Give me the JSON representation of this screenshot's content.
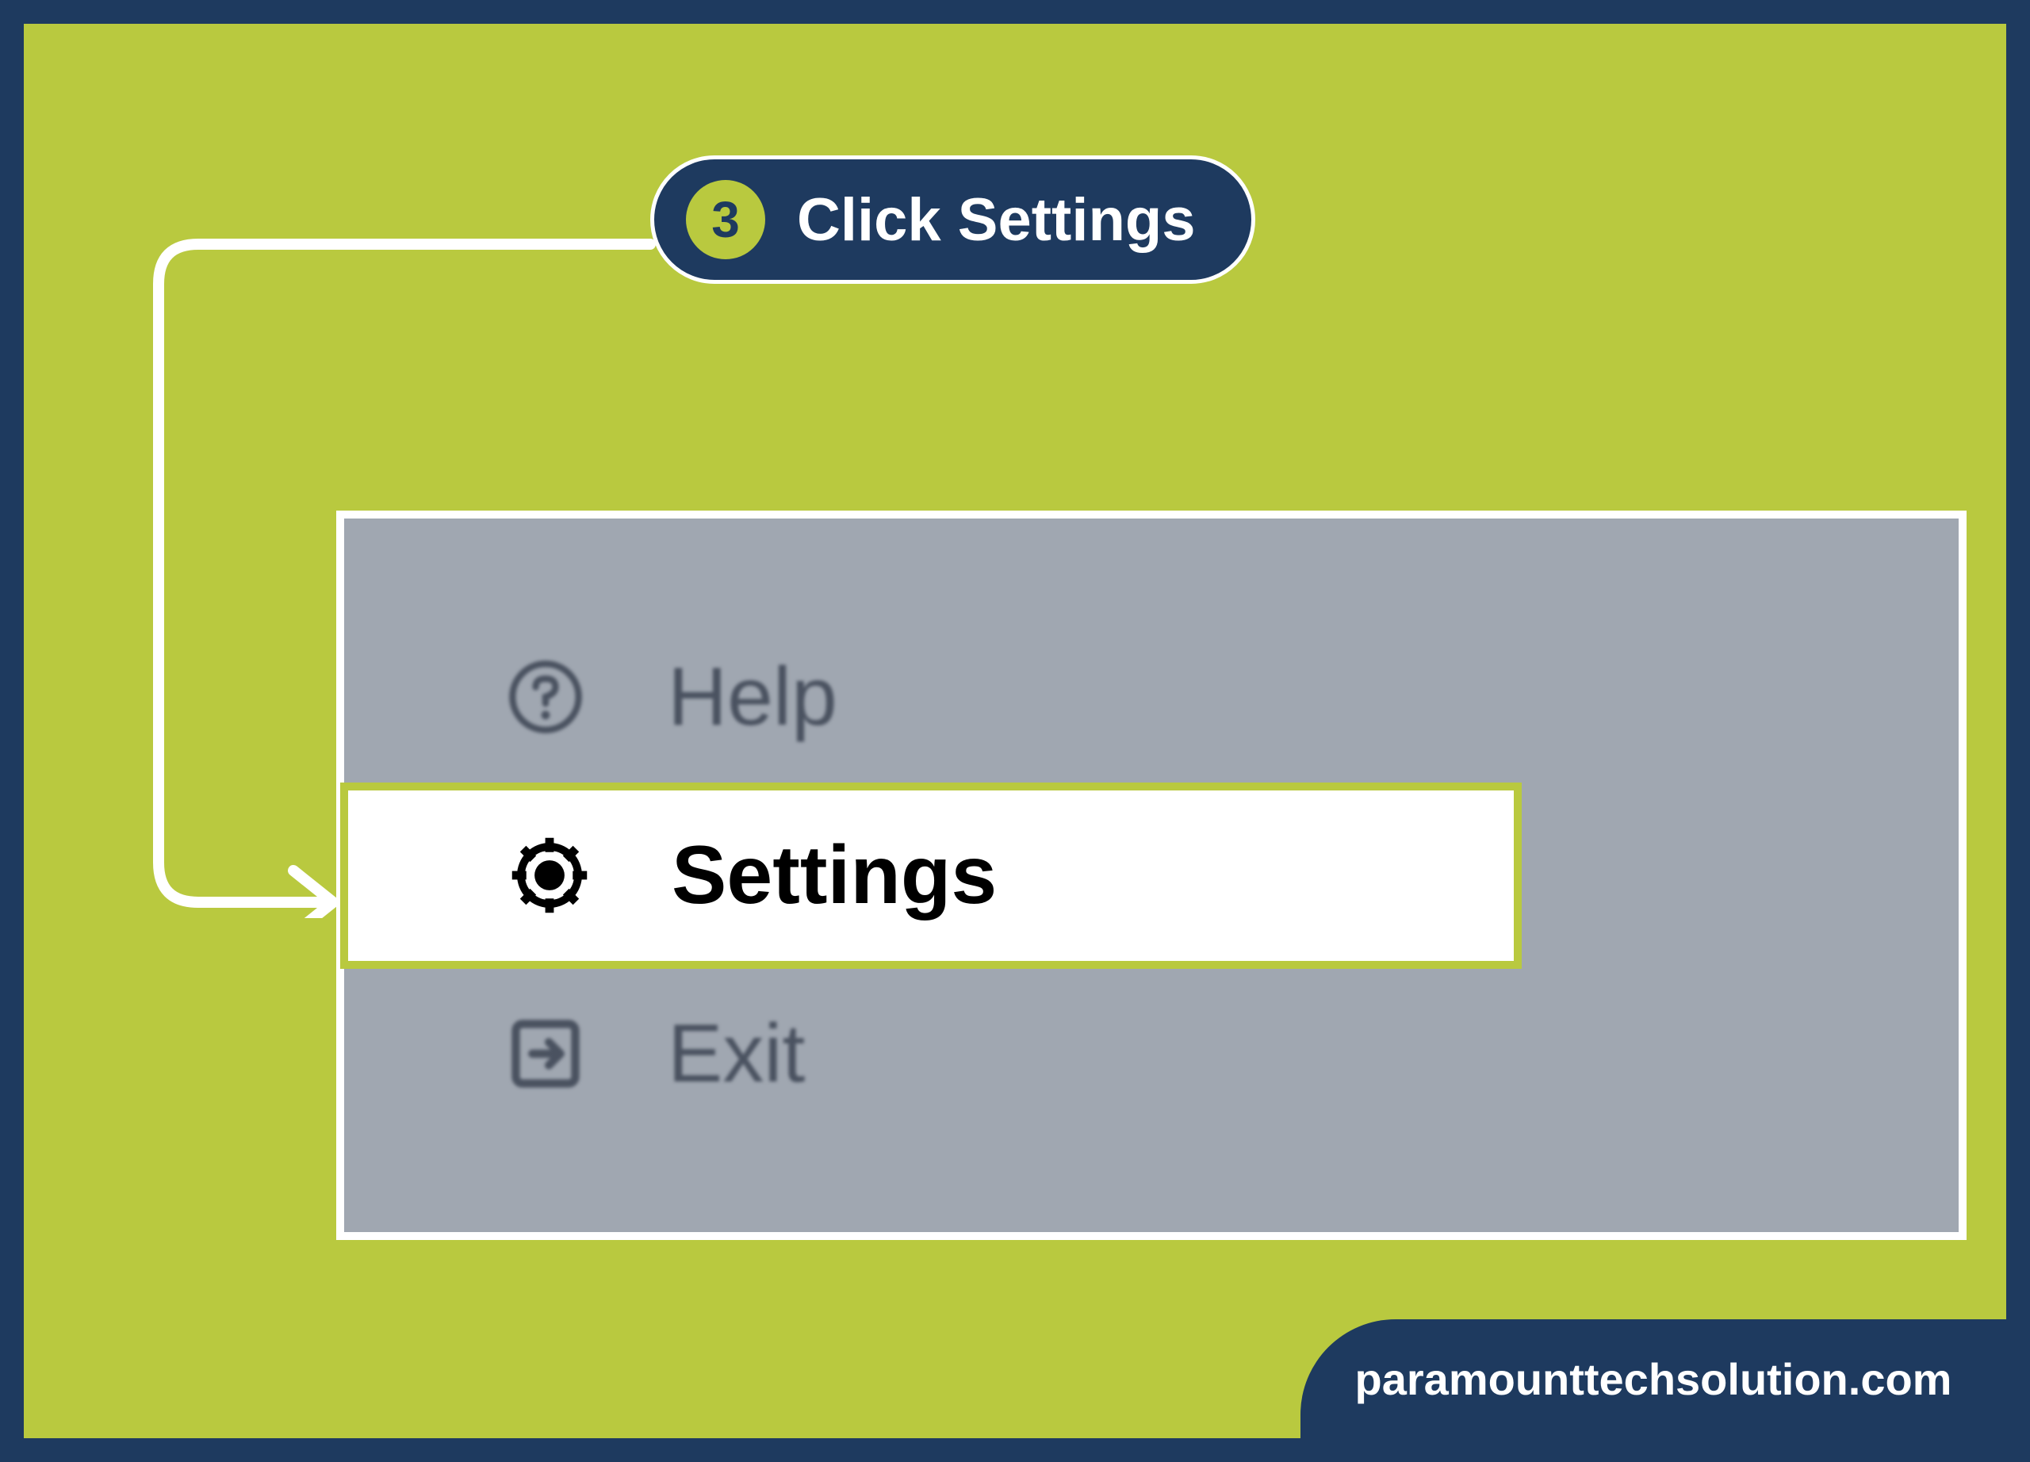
{
  "callout": {
    "step_number": "3",
    "instruction": "Click Settings"
  },
  "menu": {
    "items": [
      {
        "label": "Help",
        "icon": "question-circle-icon"
      },
      {
        "label": "Settings",
        "icon": "gear-icon",
        "highlighted": true
      },
      {
        "label": "Exit",
        "icon": "exit-icon"
      }
    ]
  },
  "footer": {
    "watermark": "paramounttechsolution.com"
  }
}
